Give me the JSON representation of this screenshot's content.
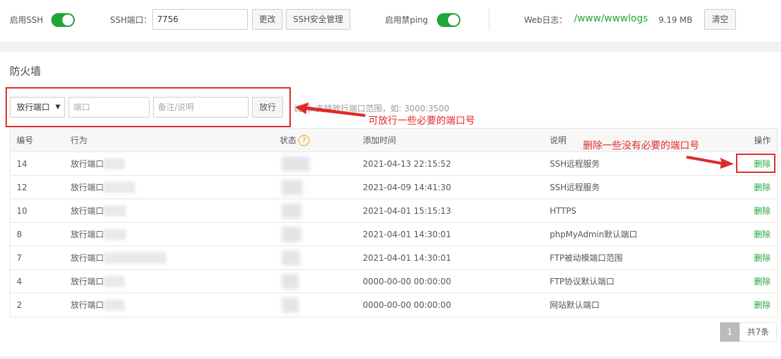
{
  "topbar": {
    "ssh_label": "启用SSH",
    "ssh_port_label": "SSH端口：",
    "ssh_port_value": "7756",
    "change_button": "更改",
    "ssh_manage_button": "SSH安全管理",
    "ping_label": "启用禁ping",
    "weblog_label": "Web日志：",
    "weblog_path": "/www/wwwlogs",
    "weblog_size": "9.19 MB",
    "clear_button": "清空"
  },
  "section_title": "防火墙",
  "form": {
    "select_value": "放行端口",
    "port_placeholder": "端口",
    "note_placeholder": "备注/说明",
    "allow_button": "放行",
    "hint": "说明: 支持放行端口范围，如: 3000:3500"
  },
  "annotations": {
    "add_note": "可放行一些必要的端口号",
    "delete_note": "删除一些没有必要的端口号"
  },
  "table": {
    "headers": [
      "编号",
      "行为",
      "状态",
      "添加时间",
      "说明",
      "操作"
    ],
    "rows": [
      {
        "id": "14",
        "action": "放行端口",
        "time": "2021-04-13 22:15:52",
        "note": "SSH远程服务",
        "op": "删除"
      },
      {
        "id": "12",
        "action": "放行端口",
        "time": "2021-04-09 14:41:30",
        "note": "SSH远程服务",
        "op": "删除"
      },
      {
        "id": "10",
        "action": "放行端口",
        "time": "2021-04-01 15:15:13",
        "note": "HTTPS",
        "op": "删除"
      },
      {
        "id": "8",
        "action": "放行端口",
        "time": "2021-04-01 14:30:01",
        "note": "phpMyAdmin默认端口",
        "op": "删除"
      },
      {
        "id": "7",
        "action": "放行端口",
        "time": "2021-04-01 14:30:01",
        "note": "FTP被动模端口范围",
        "op": "删除"
      },
      {
        "id": "4",
        "action": "放行端口",
        "time": "0000-00-00 00:00:00",
        "note": "FTP协议默认端口",
        "op": "删除"
      },
      {
        "id": "2",
        "action": "放行端口",
        "time": "0000-00-00 00:00:00",
        "note": "网站默认端口",
        "op": "删除"
      }
    ]
  },
  "pagination": {
    "current": "1",
    "total": "共7条"
  },
  "colors": {
    "accent": "#20a53a",
    "annotation": "#e02a2a"
  }
}
